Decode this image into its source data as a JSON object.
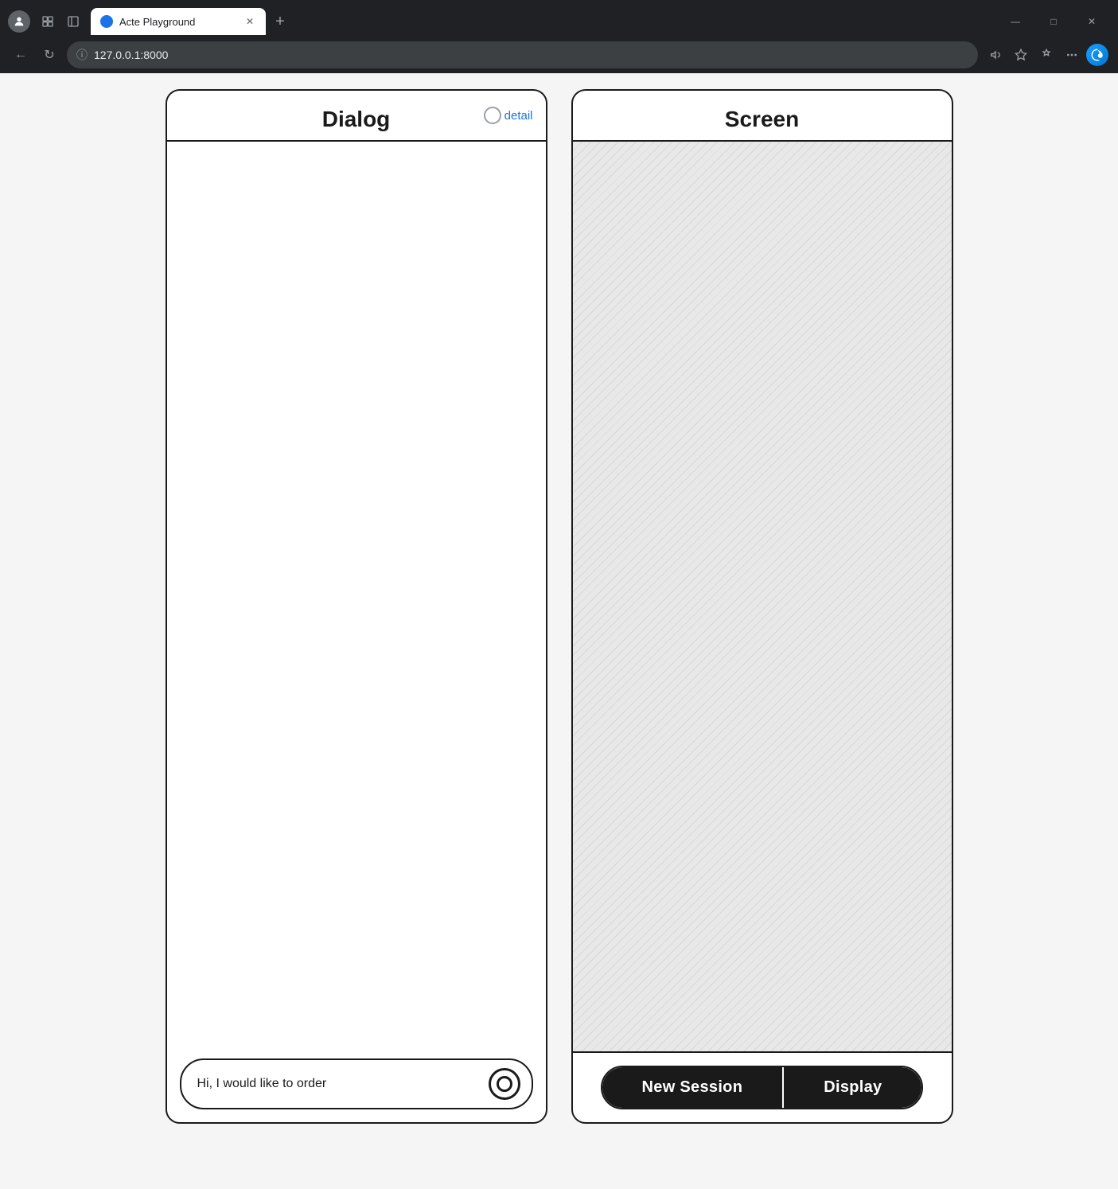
{
  "browser": {
    "tab_title": "Acte Playground",
    "address": "127.0.0.1:8000",
    "window_controls": {
      "minimize": "—",
      "maximize": "□",
      "close": "✕"
    }
  },
  "dialog": {
    "title": "Dialog",
    "detail_label": "detail",
    "body_content": ""
  },
  "chat_input": {
    "placeholder": "Hi, I would like to order",
    "value": "Hi, I would like to order"
  },
  "screen": {
    "title": "Screen",
    "buttons": {
      "new_session": "New Session",
      "display": "Display"
    }
  }
}
